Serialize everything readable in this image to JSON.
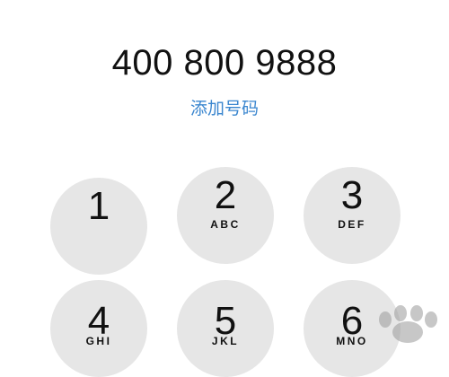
{
  "dialer": {
    "number": "400 800 9888",
    "add_number_label": "添加号码"
  },
  "keypad": {
    "keys": [
      {
        "digit": "1",
        "letters": ""
      },
      {
        "digit": "2",
        "letters": "ABC"
      },
      {
        "digit": "3",
        "letters": "DEF"
      },
      {
        "digit": "4",
        "letters": "GHI"
      },
      {
        "digit": "5",
        "letters": "JKL"
      },
      {
        "digit": "6",
        "letters": "MNO"
      }
    ]
  },
  "colors": {
    "link": "#3a86cf",
    "key_background": "#e6e6e6",
    "text": "#111111"
  },
  "watermark": {
    "icon": "paw-print-icon"
  }
}
